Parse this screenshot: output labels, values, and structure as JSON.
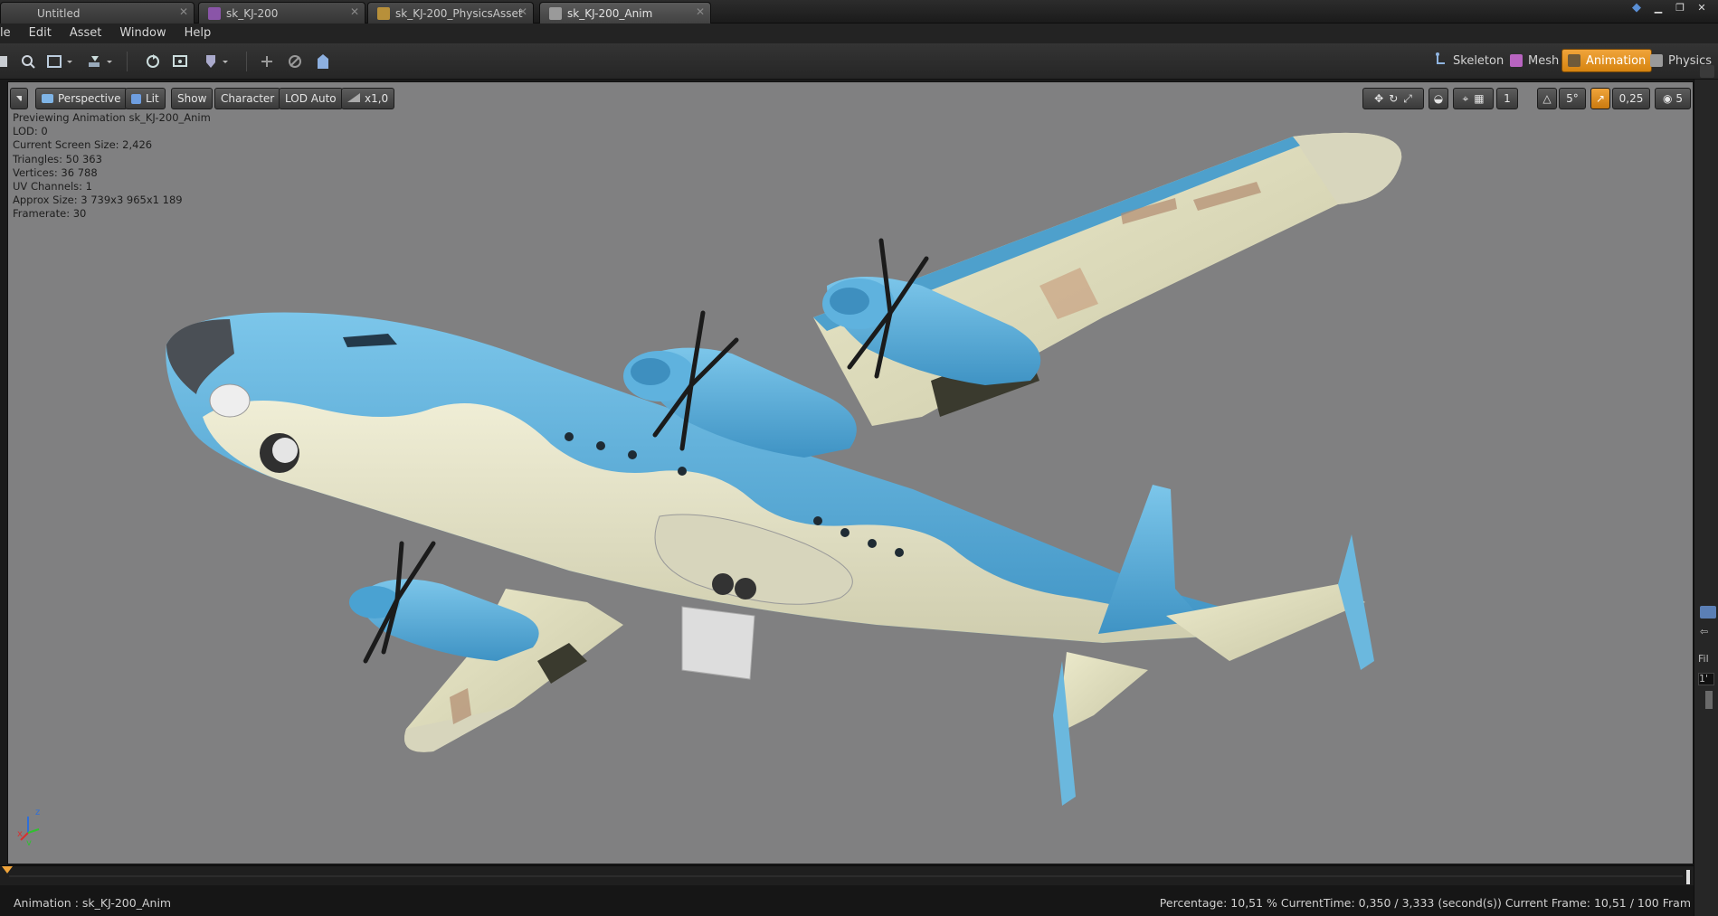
{
  "tabs": [
    {
      "label": "Untitled",
      "icon": "blueprint-icon"
    },
    {
      "label": "sk_KJ-200",
      "icon": "skeleton-icon"
    },
    {
      "label": "sk_KJ-200_PhysicsAsset",
      "icon": "physics-asset-icon"
    },
    {
      "label": "sk_KJ-200_Anim",
      "icon": "animation-icon"
    }
  ],
  "tab_close_glyph": "✕",
  "window_controls": [
    "minimize-icon",
    "restore-icon",
    "close-icon"
  ],
  "menu": [
    "le",
    "Edit",
    "Asset",
    "Window",
    "Help"
  ],
  "modes": [
    {
      "label": "Skeleton",
      "icon": "skeleton-icon",
      "active": false
    },
    {
      "label": "Mesh",
      "icon": "mesh-icon",
      "active": false
    },
    {
      "label": "Animation",
      "icon": "animation-icon",
      "active": true
    },
    {
      "label": "Physics",
      "icon": "physics-icon",
      "active": false
    }
  ],
  "viewport": {
    "buttons": [
      "Perspective",
      "Lit",
      "Show",
      "Character",
      "LOD Auto",
      "x1,0"
    ],
    "grid_snap": "1",
    "rotation_snap": "5°",
    "scale_snap": "0,25",
    "camera_speed": "5",
    "stats": [
      "Previewing Animation sk_KJ-200_Anim",
      "LOD: 0",
      "Current Screen Size: 2,426",
      "Triangles: 50 363",
      "Vertices: 36 788",
      "UV Channels: 1",
      "Approx Size: 3 739x3 965x1 189",
      "Framerate: 30"
    ],
    "axis_labels": {
      "x": "x",
      "y": "y",
      "z": "z"
    }
  },
  "status": {
    "animation_label": "Animation :",
    "animation_name": "sk_KJ-200_Anim",
    "info": "Percentage:  10,51 %  CurrentTime:  0,350 / 3,333 (second(s))  Current Frame:  10,51 / 100 Fram"
  },
  "right_panel": {
    "label": "Fil",
    "value": "1'"
  },
  "colors": {
    "accent": "#f0a43a",
    "viewport_bg": "#808081",
    "plane_blue": "#5aaed8",
    "plane_beige": "#e8e6c8"
  }
}
